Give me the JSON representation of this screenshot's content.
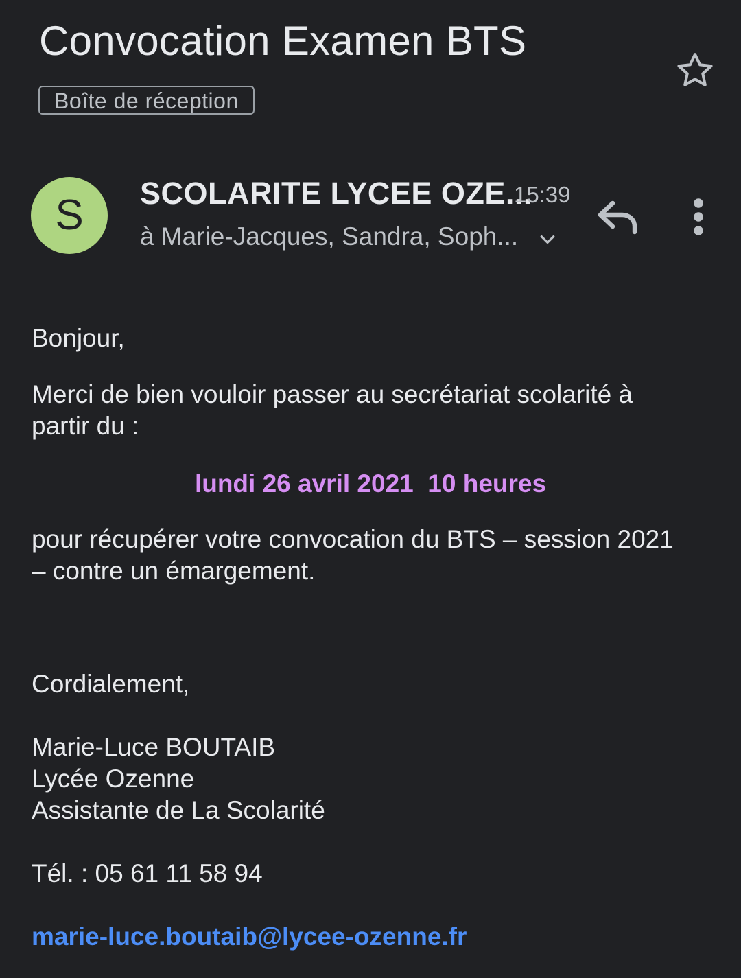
{
  "header": {
    "subject": "Convocation Examen BTS",
    "label": "Boîte de réception",
    "star_icon": "star-outline-icon"
  },
  "message": {
    "avatar_letter": "S",
    "avatar_color": "#aed581",
    "sender": "SCOLARITE LYCEE OZE...",
    "time": "15:39",
    "recipients": "à Marie-Jacques, Sandra, Soph...",
    "icons": {
      "expand": "chevron-down-icon",
      "reply": "reply-icon",
      "more": "more-vert-icon"
    }
  },
  "body": {
    "greeting": "Bonjour,",
    "intro_line1": "Merci de bien vouloir passer au secrétariat scolarité à",
    "intro_line2": "partir du  :",
    "highlight": "lundi 26 avril 2021  10 heures",
    "highlight_color": "#d58ef2",
    "purpose_line1": "pour récupérer votre convocation du BTS – session 2021",
    "purpose_line2": "– contre un émargement.",
    "closing": "Cordialement,",
    "signature_name": "Marie-Luce BOUTAIB",
    "signature_school": "Lycée Ozenne",
    "signature_role": "Assistante de La Scolarité",
    "phone": "Tél. : 05 61 11 58 94",
    "email": "marie-luce.boutaib@lycee-ozenne.fr",
    "link_color": "#4c8df6"
  }
}
